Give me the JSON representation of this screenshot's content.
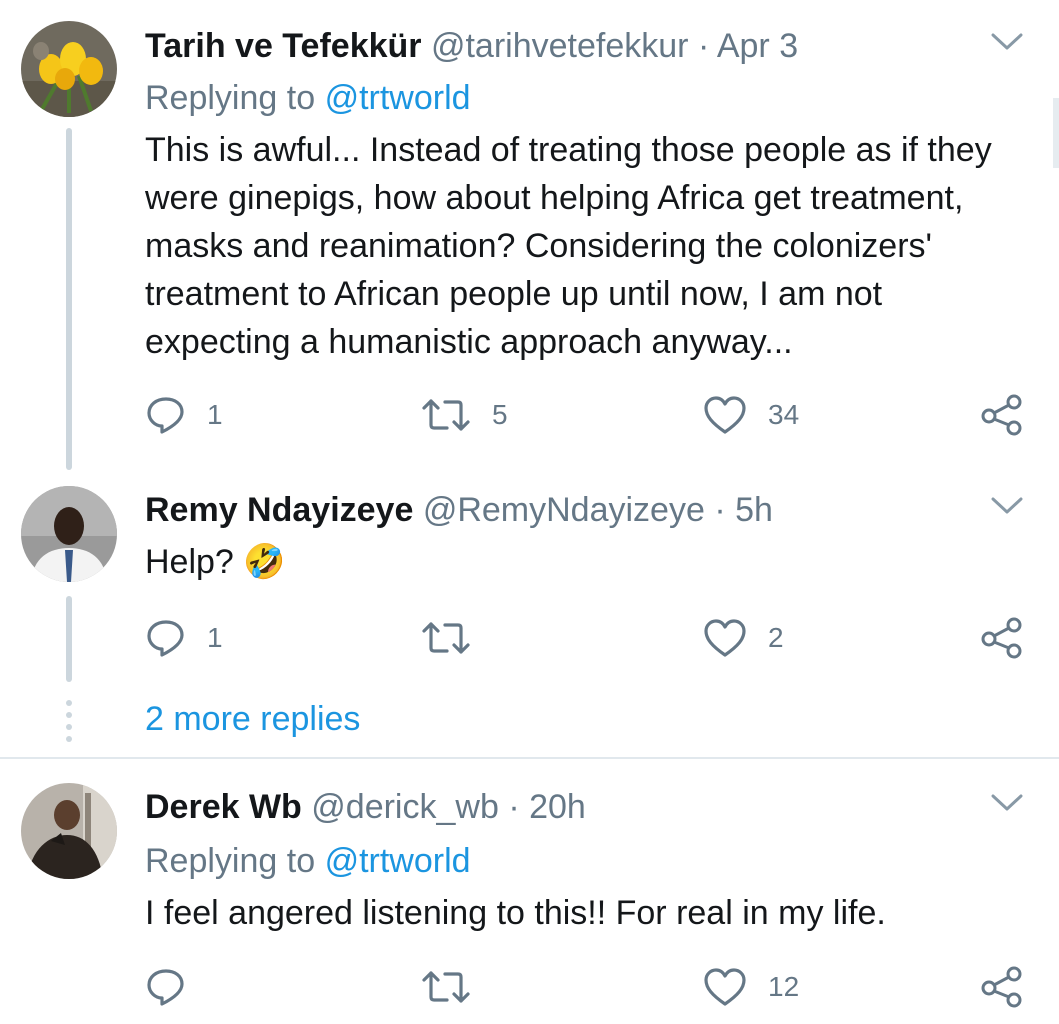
{
  "tweets": [
    {
      "name": "Tarih ve Tefekkür",
      "handle": "@tarihvetefekkur",
      "separator": "·",
      "time": "Apr 3",
      "replying_label": "Replying to",
      "replying_to": "@trtworld",
      "text": "This is awful... Instead of treating those people as if they were ginepigs, how about helping Africa get treatment, masks and reanimation? Considering the colonizers' treatment to African people up until now, I am not expecting a humanistic approach anyway...",
      "replies": "1",
      "retweets": "5",
      "likes": "34",
      "avatar_icon": "yellow-crocus-flowers"
    },
    {
      "name": "Remy Ndayizeye",
      "handle": "@RemyNdayizeye",
      "separator": "·",
      "time": "5h",
      "text": "Help? 🤣",
      "replies": "1",
      "retweets": "",
      "likes": "2",
      "avatar_icon": "man-in-white-shirt"
    },
    {
      "name": "Derek Wb",
      "handle": "@derick_wb",
      "separator": "·",
      "time": "20h",
      "replying_label": "Replying to",
      "replying_to": "@trtworld",
      "text": "I feel angered listening to this!! For real in my life.",
      "replies": "",
      "retweets": "",
      "likes": "12",
      "avatar_icon": "person-selfie"
    }
  ],
  "more_replies": "2 more replies",
  "colors": {
    "text": "#14171a",
    "secondary": "#657786",
    "link": "#1b95e0",
    "thread_line": "#ccd6dd"
  }
}
